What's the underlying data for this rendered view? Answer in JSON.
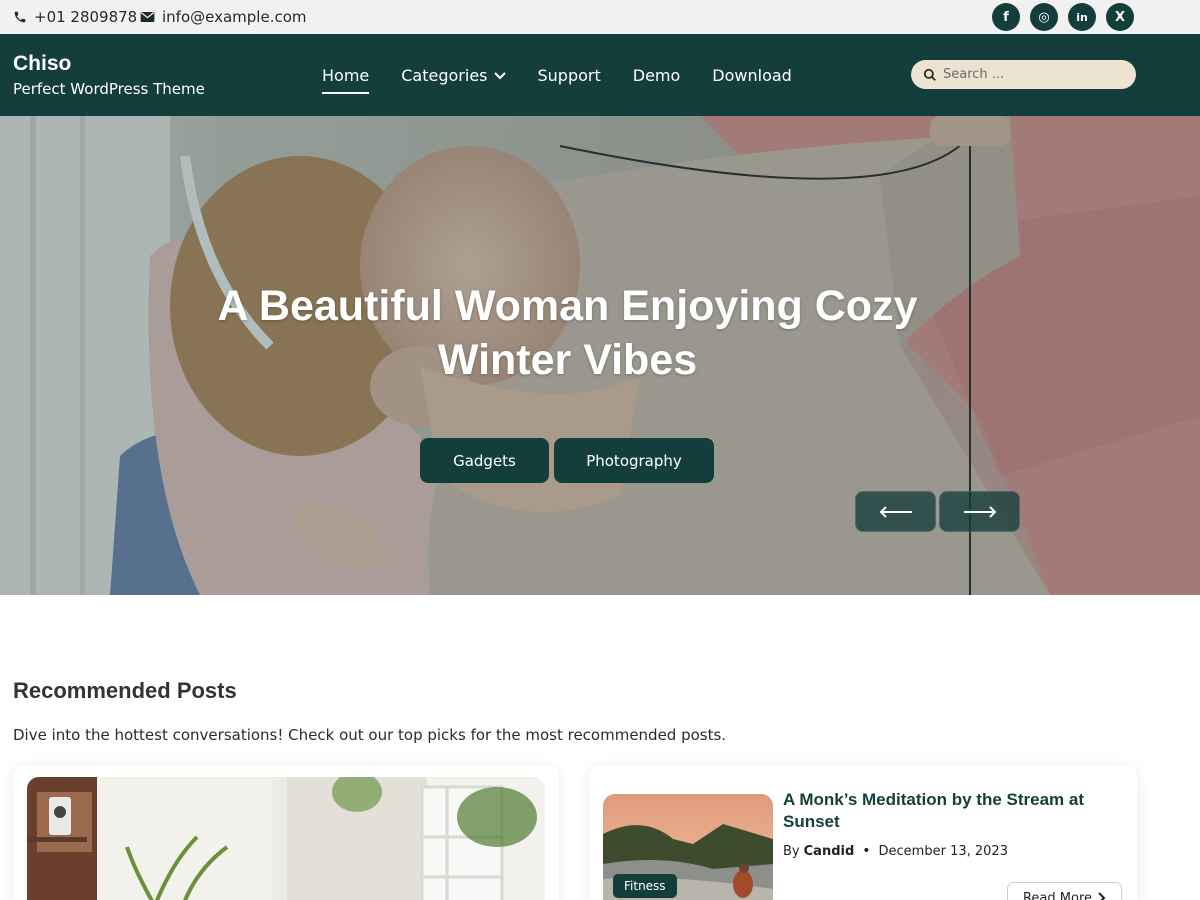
{
  "topbar": {
    "phone": "+01 2809878",
    "email": "info@example.com",
    "social": [
      {
        "icon": "facebook-icon",
        "glyph": "f"
      },
      {
        "icon": "instagram-icon",
        "glyph": "◎"
      },
      {
        "icon": "linkedin-icon",
        "glyph": "in"
      },
      {
        "icon": "x-twitter-icon",
        "glyph": "X"
      }
    ]
  },
  "header": {
    "site_title": "Chiso",
    "tagline": "Perfect WordPress Theme",
    "nav": [
      "Home",
      "Categories",
      "Support",
      "Demo",
      "Download"
    ],
    "active_nav": "Home",
    "search_placeholder": "Search ..."
  },
  "hero": {
    "title": "A Beautiful Woman Enjoying Cozy Winter Vibes",
    "categories": [
      "Gadgets",
      "Photography"
    ],
    "prev_icon": "arrow-left-icon",
    "next_icon": "arrow-right-icon"
  },
  "recommended": {
    "heading": "Recommended Posts",
    "description": "Dive into the hottest conversations! Check out our top picks for the most recommended posts.",
    "posts": [
      {
        "title": "A Monk’s Meditation by the Stream at Sunset",
        "category": "Fitness",
        "author_prefix": "By",
        "author": "Candid",
        "date": "December 13, 2023",
        "read_more": "Read More"
      }
    ]
  },
  "colors": {
    "primary": "#133e3c",
    "topbar_bg": "#f1f1f1",
    "search_bg": "#ece4d0",
    "accent_text": "#133e3c"
  }
}
